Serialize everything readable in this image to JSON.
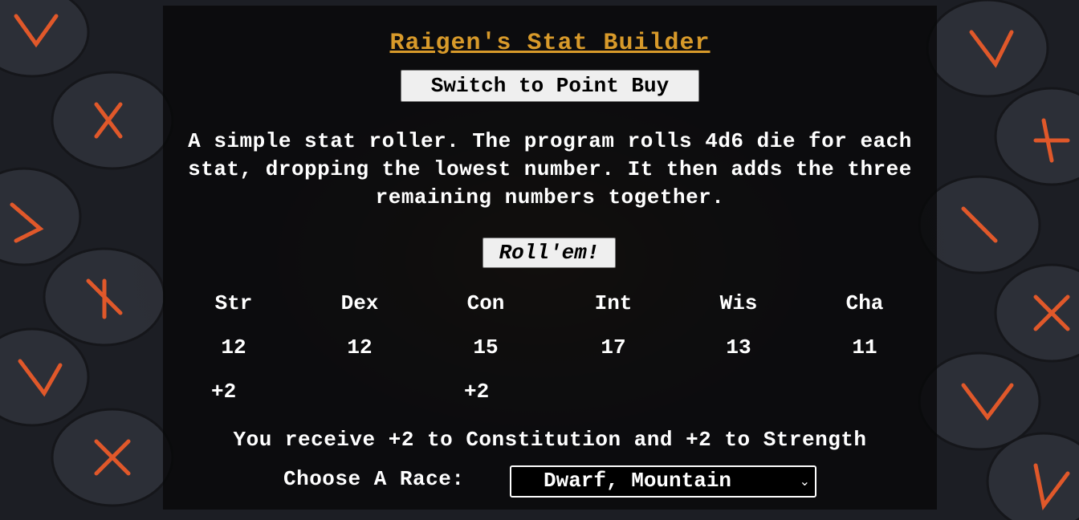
{
  "app": {
    "title": "Raigen's Stat Builder",
    "switch_label": "Switch to Point Buy",
    "description": "A simple stat roller. The program rolls 4d6 die for each stat, dropping the lowest number. It then adds the three remaining numbers together.",
    "roll_label": "Roll'em!"
  },
  "stats": [
    {
      "name": "Str",
      "value": "12",
      "bonus": "+2"
    },
    {
      "name": "Dex",
      "value": "12",
      "bonus": ""
    },
    {
      "name": "Con",
      "value": "15",
      "bonus": "+2"
    },
    {
      "name": "Int",
      "value": "17",
      "bonus": ""
    },
    {
      "name": "Wis",
      "value": "13",
      "bonus": ""
    },
    {
      "name": "Cha",
      "value": "11",
      "bonus": ""
    }
  ],
  "receive_text": "You receive +2 to Constitution and +2 to Strength",
  "race": {
    "label": "Choose A Race:",
    "selected": "Dwarf, Mountain"
  },
  "colors": {
    "title": "#d89a2a",
    "rune_glow": "#e0582a"
  }
}
